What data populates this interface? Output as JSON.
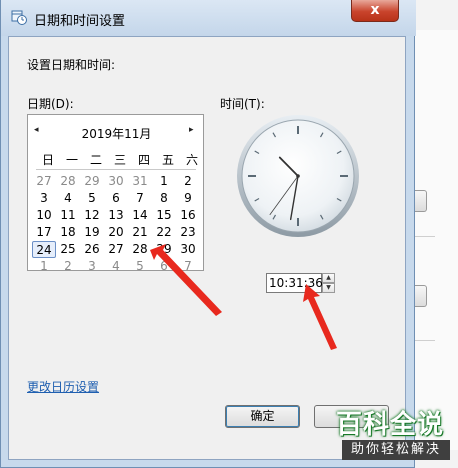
{
  "window": {
    "title": "日期和时间设置",
    "close_glyph": "x"
  },
  "heading": "设置日期和时间:",
  "date_label": "日期(D):",
  "time_label": "时间(T):",
  "calendar": {
    "month_label": "2019年11月",
    "prev_glyph": "◂",
    "next_glyph": "▸",
    "weekdays": [
      "日",
      "一",
      "二",
      "三",
      "四",
      "五",
      "六"
    ],
    "weeks": [
      [
        "27",
        "28",
        "29",
        "30",
        "31",
        "1",
        "2"
      ],
      [
        "3",
        "4",
        "5",
        "6",
        "7",
        "8",
        "9"
      ],
      [
        "10",
        "11",
        "12",
        "13",
        "14",
        "15",
        "16"
      ],
      [
        "17",
        "18",
        "19",
        "20",
        "21",
        "22",
        "23"
      ],
      [
        "24",
        "25",
        "26",
        "27",
        "28",
        "29",
        "30"
      ],
      [
        "1",
        "2",
        "3",
        "4",
        "5",
        "6",
        "7"
      ]
    ],
    "muted_first_row_count": 5,
    "selected_day": "24"
  },
  "time": {
    "value": "10:31:36",
    "hour": 10,
    "minute": 31,
    "second": 36
  },
  "change_calendar_link": "更改日历设置",
  "buttons": {
    "ok": "确定",
    "cancel": ""
  },
  "watermark": {
    "top": "百科全说",
    "bottom": "助你轻松解决"
  },
  "colors": {
    "link": "#1f5fb0",
    "arrow": "#e8291e",
    "close": "#c9442c"
  }
}
